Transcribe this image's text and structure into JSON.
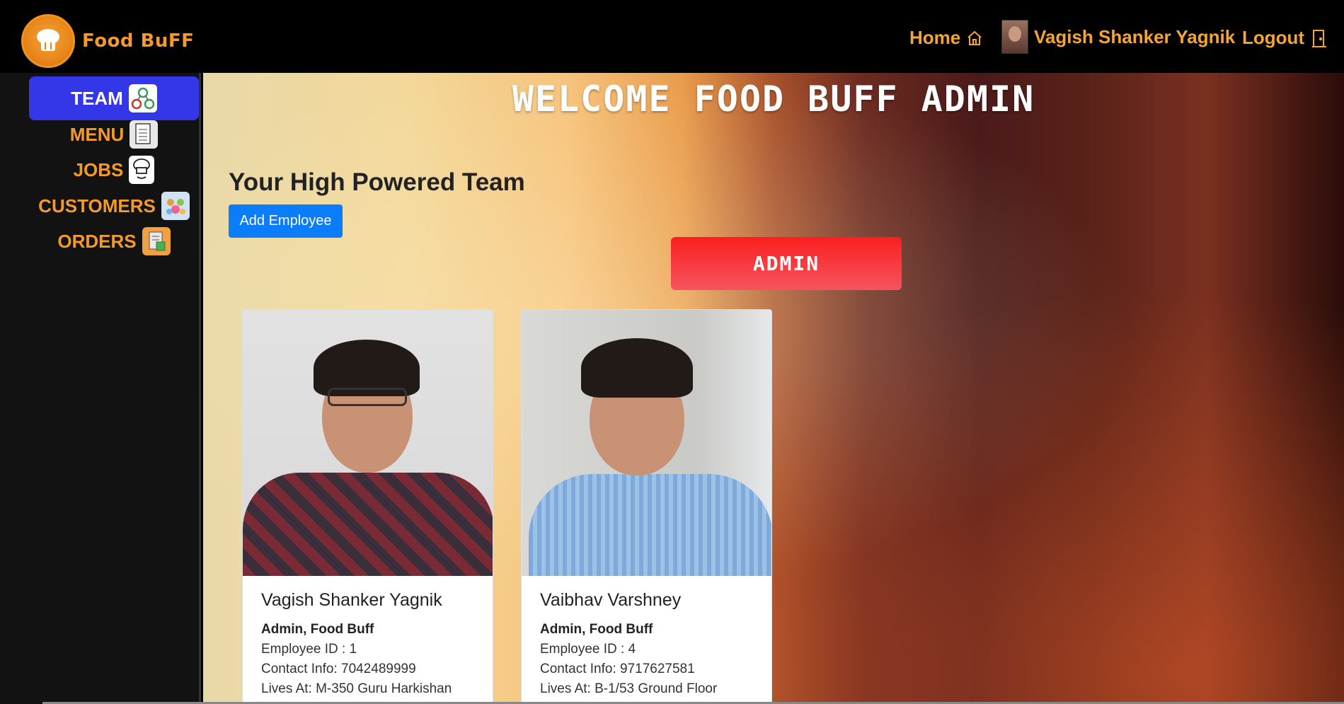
{
  "brand": {
    "name": "Food BuFF",
    "logo_icon": "chef-hat-icon"
  },
  "nav": {
    "home_label": "Home",
    "home_icon": "home-icon",
    "user_name": "Vagish Shanker Yagnik",
    "logout_label": "Logout",
    "logout_icon": "door-icon"
  },
  "sidebar": {
    "items": [
      {
        "label": "TEAM",
        "icon": "team-icon",
        "active": true
      },
      {
        "label": "MENU",
        "icon": "menu-card-icon",
        "active": false
      },
      {
        "label": "JOBS",
        "icon": "chef-icon",
        "active": false
      },
      {
        "label": "CUSTOMERS",
        "icon": "customers-icon",
        "active": false
      },
      {
        "label": "ORDERS",
        "icon": "orders-icon",
        "active": false
      }
    ]
  },
  "main": {
    "welcome": "WELCOME FOOD BUFF ADMIN",
    "team_heading": "Your High Powered Team",
    "add_button": "Add Employee",
    "role_section": "ADMIN",
    "employees": [
      {
        "name": "Vagish Shanker Yagnik",
        "role": "Admin, Food Buff",
        "employee_id": "Employee ID : 1",
        "contact": "Contact Info: 7042489999",
        "address": "Lives At: M-350 Guru Harkishan"
      },
      {
        "name": "Vaibhav Varshney",
        "role": "Admin, Food Buff",
        "employee_id": "Employee ID : 4",
        "contact": "Contact Info: 9717627581",
        "address": "Lives At: B-1/53 Ground Floor"
      }
    ]
  },
  "colors": {
    "accent_orange": "#f59a2a",
    "active_blue": "#3437e8",
    "button_blue": "#0b7dfb",
    "admin_red": "#fb1f1f"
  }
}
